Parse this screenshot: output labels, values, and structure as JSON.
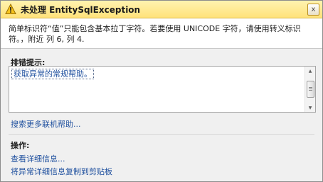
{
  "dialog": {
    "title": "未处理 EntitySqlException",
    "close_glyph": "x",
    "message": "简单标识符“值”只能包含基本拉丁字符。若要使用 UNICODE 字符，请使用转义标识符。，附近 列 6, 列 4.",
    "troubleshooting_label": "排错提示:",
    "hints": [
      "获取异常的常规帮助。"
    ],
    "search_more_help_link": "搜索更多联机帮助...",
    "actions_label": "操作:",
    "actions": [
      "查看详细信息...",
      "将异常详细信息复制到剪贴板"
    ],
    "icons": {
      "title": "warning-icon",
      "close": "close-icon",
      "scroll_up": "scroll-up-arrow-icon",
      "scroll_down": "scroll-down-arrow-icon"
    },
    "colors": {
      "titlebar": "#ffe27a",
      "link": "#1e4f9e"
    }
  }
}
